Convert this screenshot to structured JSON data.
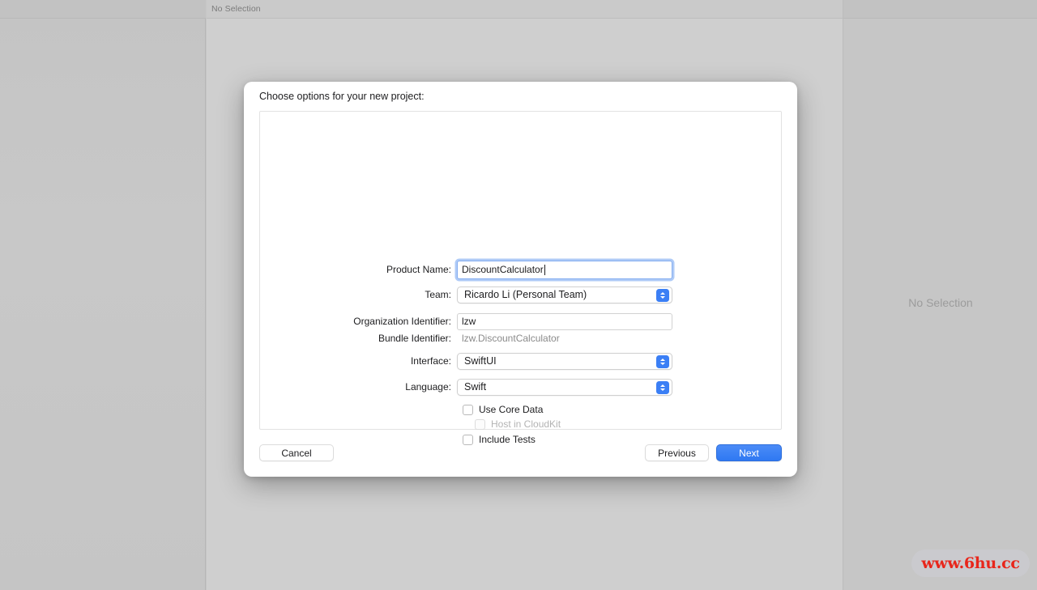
{
  "window": {
    "editor_status": "No Selection",
    "inspector_status": "No Selection"
  },
  "watermark": {
    "text": "www.6hu.cc",
    "color": "#e8261b"
  },
  "dialog": {
    "title": "Choose options for your new project:",
    "fields": [
      {
        "label": "Product Name:",
        "value": "DiscountCalculator",
        "type": "text",
        "focused": true
      },
      {
        "label": "Team:",
        "value": "Ricardo Li (Personal Team)",
        "type": "popup"
      },
      {
        "label": "Organization Identifier:",
        "value": "lzw",
        "type": "text",
        "focused": false
      },
      {
        "label": "Bundle Identifier:",
        "value": "lzw.DiscountCalculator",
        "type": "static"
      },
      {
        "label": "Interface:",
        "value": "SwiftUI",
        "type": "popup"
      },
      {
        "label": "Language:",
        "value": "Swift",
        "type": "popup"
      }
    ],
    "checkboxes": [
      {
        "label": "Use Core Data",
        "checked": false,
        "disabled": false
      },
      {
        "label": "Host in CloudKit",
        "checked": false,
        "disabled": true
      },
      {
        "label": "Include Tests",
        "checked": false,
        "disabled": false
      }
    ],
    "buttons": {
      "cancel": "Cancel",
      "previous": "Previous",
      "next": "Next"
    },
    "accent_color": "#3b7ff5"
  }
}
